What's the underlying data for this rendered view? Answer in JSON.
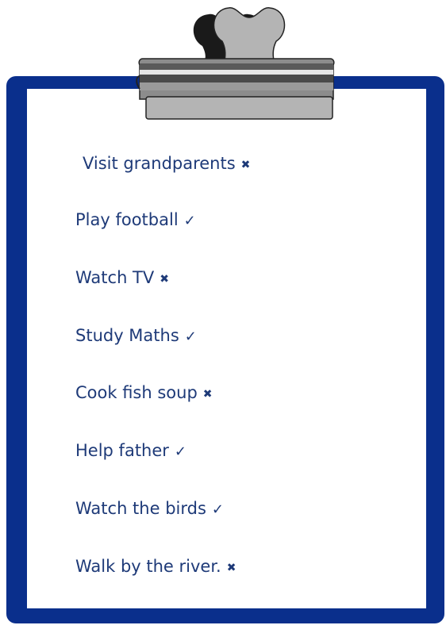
{
  "items": [
    {
      "text": "Visit grandparents",
      "mark": "✖"
    },
    {
      "text": "Play football",
      "mark": "✓"
    },
    {
      "text": "Watch TV",
      "mark": "✖"
    },
    {
      "text": "Study Maths",
      "mark": "✓"
    },
    {
      "text": "Cook fish soup",
      "mark": "✖"
    },
    {
      "text": "Help father",
      "mark": "✓"
    },
    {
      "text": "Watch the birds",
      "mark": "✓"
    },
    {
      "text": "Walk by the river.",
      "mark": "✖"
    }
  ],
  "colors": {
    "board": "#0a2f8c",
    "paper": "#ffffff",
    "text": "#1e3a78",
    "clip_dark": "#4a4a4a",
    "clip_mid": "#8c8c8c",
    "clip_light": "#b4b4b4",
    "clip_highlight": "#e6e6e6"
  },
  "icons": {
    "clip": "clipboard-clip-icon",
    "done": "check-icon",
    "not_done": "cross-icon"
  }
}
